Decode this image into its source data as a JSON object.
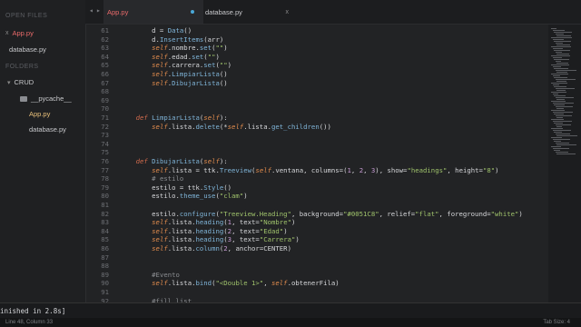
{
  "sidebar": {
    "open_files_header": "OPEN FILES",
    "open_files": [
      {
        "name": "App.py",
        "close": "x"
      },
      {
        "name": "database.py"
      }
    ],
    "folders_header": "FOLDERS",
    "tree": [
      {
        "name": "CRUD"
      },
      {
        "name": "__pycache__"
      },
      {
        "name": "App.py"
      },
      {
        "name": "database.py"
      }
    ]
  },
  "tabs": [
    {
      "label": "App.py"
    },
    {
      "label": "database.py",
      "close": "x"
    }
  ],
  "nav": {
    "back": "◂",
    "forward": "▸"
  },
  "lines": [
    {
      "n": "61",
      "code": "        d = Data()"
    },
    {
      "n": "62",
      "code": "        d.InsertItems(arr)"
    },
    {
      "n": "63",
      "code": "        self.nombre.set(\"\")"
    },
    {
      "n": "64",
      "code": "        self.edad.set(\"\")"
    },
    {
      "n": "65",
      "code": "        self.carrera.set(\"\")"
    },
    {
      "n": "66",
      "code": "        self.LimpiarLista()"
    },
    {
      "n": "67",
      "code": "        self.DibujarLista()"
    },
    {
      "n": "68",
      "code": ""
    },
    {
      "n": "69",
      "code": ""
    },
    {
      "n": "70",
      "code": ""
    },
    {
      "n": "71",
      "code": "    def LimpiarLista(self):"
    },
    {
      "n": "72",
      "code": "        self.lista.delete(*self.lista.get_children())"
    },
    {
      "n": "73",
      "code": ""
    },
    {
      "n": "74",
      "code": ""
    },
    {
      "n": "75",
      "code": ""
    },
    {
      "n": "76",
      "code": "    def DibujarLista(self):"
    },
    {
      "n": "77",
      "code": "        self.lista = ttk.Treeview(self.ventana, columns=(1, 2, 3), show=\"headings\", height=\"8\")"
    },
    {
      "n": "78",
      "code": "        # estilo"
    },
    {
      "n": "79",
      "code": "        estilo = ttk.Style()"
    },
    {
      "n": "80",
      "code": "        estilo.theme_use(\"clam\")"
    },
    {
      "n": "81",
      "code": ""
    },
    {
      "n": "82",
      "code": "        estilo.configure(\"Treeview.Heading\", background=\"#0051C8\", relief=\"flat\", foreground=\"white\")"
    },
    {
      "n": "83",
      "code": "        self.lista.heading(1, text=\"Nombre\")"
    },
    {
      "n": "84",
      "code": "        self.lista.heading(2, text=\"Edad\")"
    },
    {
      "n": "85",
      "code": "        self.lista.heading(3, text=\"Carrera\")"
    },
    {
      "n": "86",
      "code": "        self.lista.column(2, anchor=CENTER)"
    },
    {
      "n": "87",
      "code": ""
    },
    {
      "n": "88",
      "code": ""
    },
    {
      "n": "89",
      "code": "        #Evento"
    },
    {
      "n": "90",
      "code": "        self.lista.bind(\"<Double 1>\", self.obtenerFila)"
    },
    {
      "n": "91",
      "code": ""
    },
    {
      "n": "92",
      "code": "        #fill list"
    }
  ],
  "console": {
    "text": "inished in 2.8s]"
  },
  "status": {
    "left": "Line 48, Column 33",
    "right": "Tab Size: 4"
  },
  "colors": {
    "accent_red": "#e96a6a",
    "dot_blue": "#4aa8d8",
    "keyword": "#cf6a4c",
    "string": "#9fc26b"
  }
}
